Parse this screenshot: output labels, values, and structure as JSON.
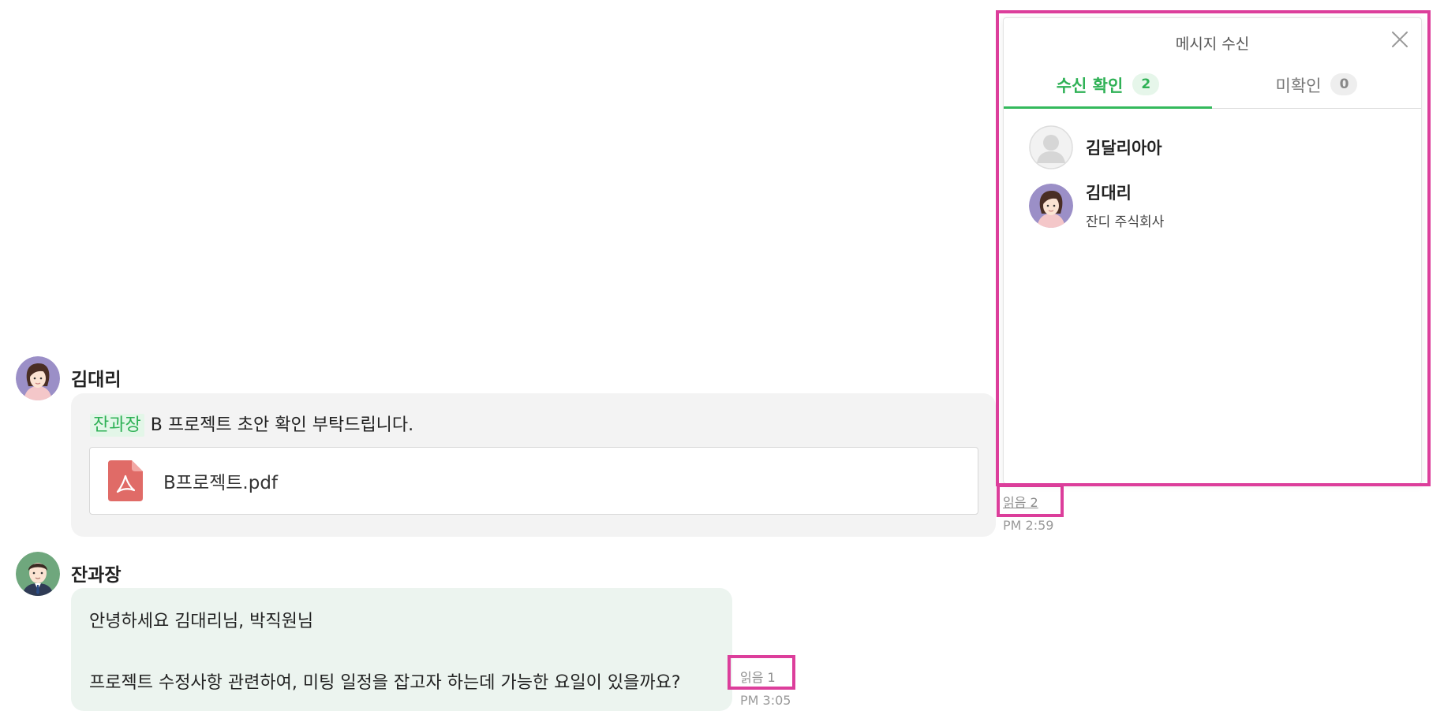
{
  "messages": [
    {
      "sender": "김대리",
      "mention": "잔과장",
      "text": "B 프로젝트 초안 확인 부탁드립니다.",
      "attachment": {
        "file_name": "B프로젝트.pdf",
        "icon": "pdf-icon"
      },
      "read_label": "읽음 2",
      "time": "PM 2:59"
    },
    {
      "sender": "잔과장",
      "lines": [
        "안녕하세요 김대리님, 박직원님",
        "프로젝트 수정사항 관련하여, 미팅 일정을 잡고자 하는데 가능한 요일이 있을까요?"
      ],
      "read_label": "읽음 1",
      "time": "PM 3:05"
    }
  ],
  "receipt_panel": {
    "title": "메시지 수신",
    "tabs": [
      {
        "label": "수신 확인",
        "count": "2",
        "active": true
      },
      {
        "label": "미확인",
        "count": "0",
        "active": false
      }
    ],
    "readers": [
      {
        "name": "김달리아아",
        "org": "",
        "avatar": "default-avatar"
      },
      {
        "name": "김대리",
        "org": "잔디 주식회사",
        "avatar": "female-avatar"
      }
    ]
  },
  "colors": {
    "accent_green": "#2fb156",
    "highlight_pink": "#dc3e9b",
    "pdf_red": "#e06b67"
  }
}
